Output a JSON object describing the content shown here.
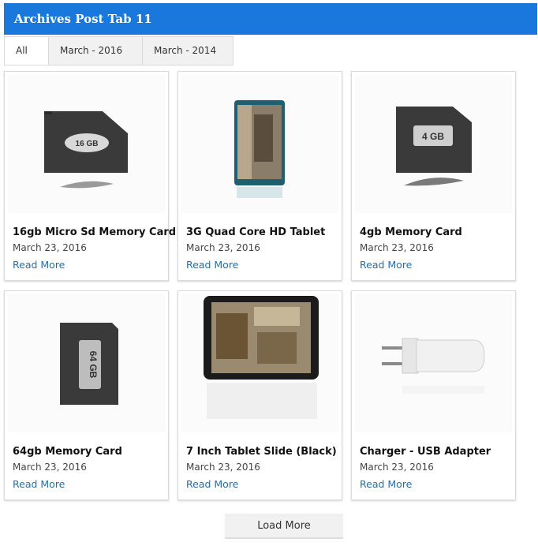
{
  "header": {
    "title": "Archives Post Tab 11"
  },
  "tabs": [
    "All",
    "March - 2016",
    "March - 2014"
  ],
  "posts": [
    {
      "title": "16gb Micro Sd Memory Card",
      "date": "March 23, 2016",
      "read_more": "Read More",
      "image_label": "16 GB"
    },
    {
      "title": "3G Quad Core HD Tablet",
      "date": "March 23, 2016",
      "read_more": "Read More"
    },
    {
      "title": "4gb Memory Card",
      "date": "March 23, 2016",
      "read_more": "Read More",
      "image_label": "4 GB"
    },
    {
      "title": "64gb Memory Card",
      "date": "March 23, 2016",
      "read_more": "Read More",
      "image_label": "64 GB"
    },
    {
      "title": "7 Inch Tablet Slide (Black)",
      "date": "March 23, 2016",
      "read_more": "Read More"
    },
    {
      "title": "Charger - USB Adapter",
      "date": "March 23, 2016",
      "read_more": "Read More"
    }
  ],
  "load_more": "Load More",
  "colors": {
    "header_bg": "#1a78dc",
    "link": "#1f6fb0"
  }
}
